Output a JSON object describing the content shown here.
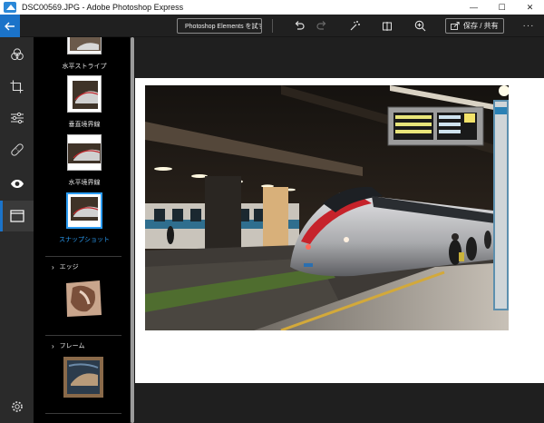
{
  "window": {
    "title": "DSC00569.JPG - Adobe Photoshop Express",
    "minimize": "—",
    "maximize": "☐",
    "close": "✕"
  },
  "toolbar": {
    "elements_label": "Photoshop Elements を試す",
    "save_label": "保存 / 共有",
    "more_label": "···",
    "icons": [
      "back-arrow",
      "undo",
      "redo",
      "auto-fix-wand",
      "compare",
      "zoom-in",
      "share"
    ]
  },
  "rail": {
    "items": [
      "looks",
      "crop",
      "adjustments",
      "healing",
      "eye",
      "borders"
    ],
    "active": "borders",
    "footer": "settings"
  },
  "panel": {
    "effects": [
      {
        "label": "水平ストライプ",
        "selected": false
      },
      {
        "label": "垂直境界線",
        "selected": false
      },
      {
        "label": "水平境界線",
        "selected": false
      },
      {
        "label": "スナップショット",
        "selected": true
      }
    ],
    "sections": [
      {
        "label": "エッジ",
        "chevron": "›"
      },
      {
        "label": "フレーム",
        "chevron": "›"
      }
    ]
  },
  "colors": {
    "accent": "#1b73c9",
    "selected_text": "#2b9cf3",
    "panel_bg": "#000000",
    "app_bg": "#1f1f1f"
  }
}
